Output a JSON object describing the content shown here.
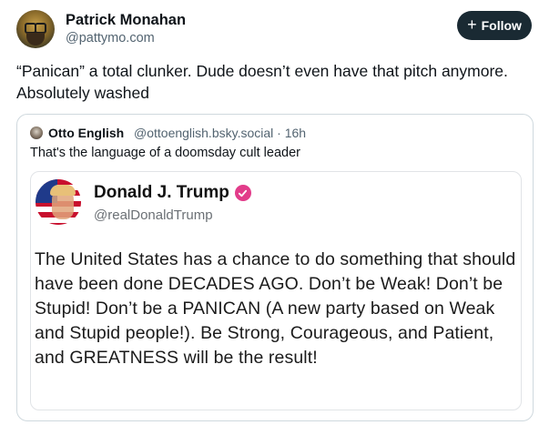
{
  "post": {
    "author_name": "Patrick Monahan",
    "author_handle": "@pattymo.com",
    "follow_label": "Follow",
    "text": "“Panican” a total clunker. Dude doesn’t even have that pitch anymore. Absolutely washed"
  },
  "quote": {
    "author_name": "Otto English",
    "author_handle_time": "@ottoenglish.bsky.social · 16h",
    "text": "That's the language of a doomsday cult leader"
  },
  "embedded_post": {
    "author_name": "Donald J. Trump",
    "author_handle": "@realDonaldTrump",
    "text": "The United States has a chance to do something that should have been done DECADES AGO. Don’t be Weak! Don’t be Stupid! Don’t be a PANICAN (A new party based on Weak and Stupid people!). Be Strong, Courageous, and Patient, and GREATNESS will be the result!"
  },
  "colors": {
    "follow_button": "#1a2a33",
    "verified_badge": "#e23c8a",
    "secondary_text": "#536471"
  },
  "icons": {
    "follow": "plus-icon",
    "verified": "verified-badge-icon"
  }
}
